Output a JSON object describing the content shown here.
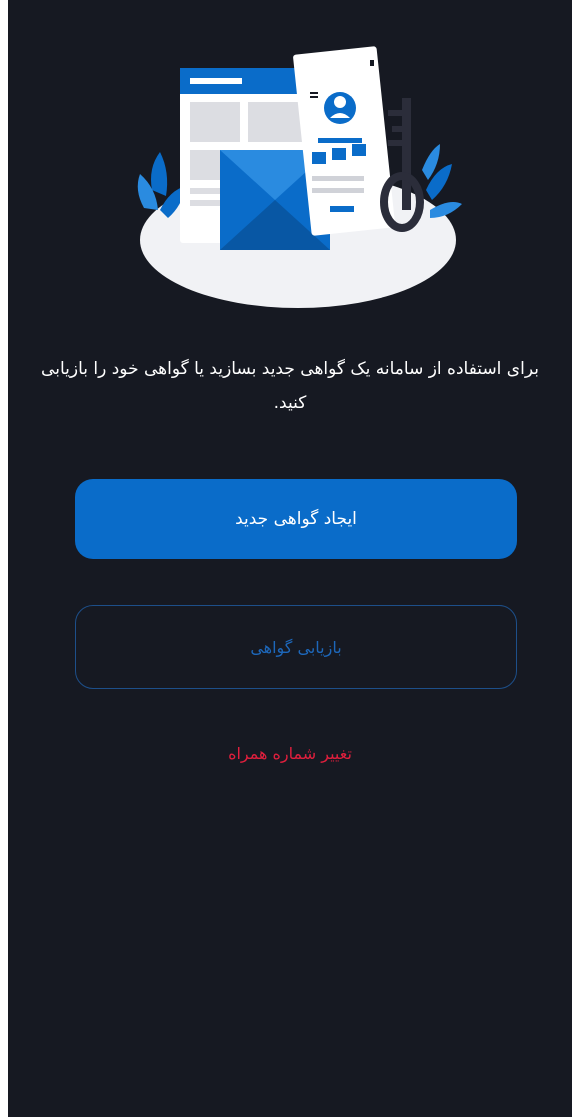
{
  "message": "برای استفاده از سامانه یک گواهی جدید بسازید یا گواهی خود را بازیابی کنید.",
  "buttons": {
    "create": "ایجاد گواهی جدید",
    "restore": "بازیابی گواهی"
  },
  "change_phone": "تغییر شماره همراه",
  "colors": {
    "background": "#161922",
    "primary": "#0a6cc9",
    "outline_border": "#1d4f8a",
    "outline_text": "#1d67ba",
    "danger": "#e01f3d"
  },
  "illustration": {
    "icons": [
      "browser-window-icon",
      "envelope-icon",
      "profile-card-icon",
      "key-icon",
      "leaf-icon"
    ]
  }
}
